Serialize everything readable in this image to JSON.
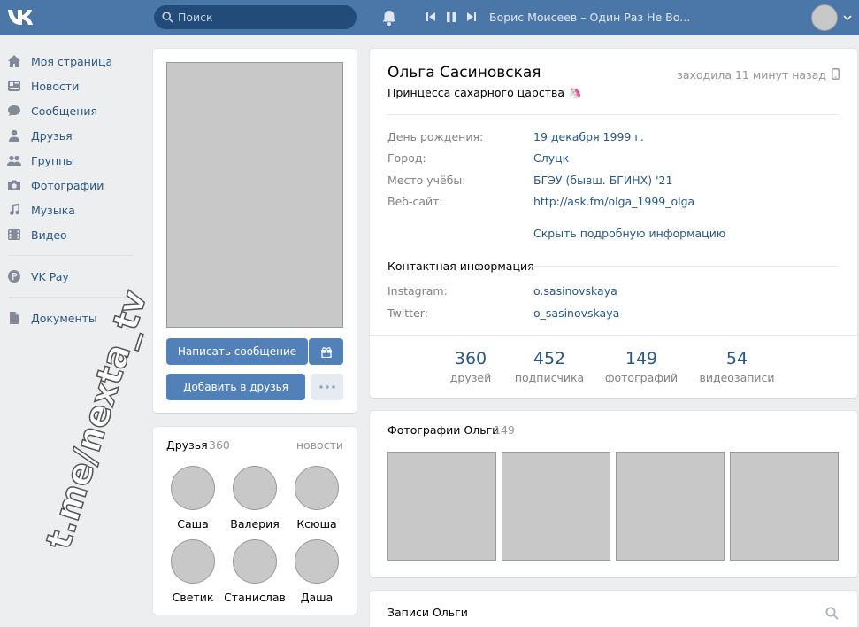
{
  "header": {
    "search_placeholder": "Поиск",
    "now_playing": "Борис Моисеев – Один Раз Не Во..."
  },
  "menu": [
    {
      "label": "Моя страница",
      "icon": "home-icon"
    },
    {
      "label": "Новости",
      "icon": "news-icon"
    },
    {
      "label": "Сообщения",
      "icon": "messages-icon"
    },
    {
      "label": "Друзья",
      "icon": "friends-icon"
    },
    {
      "label": "Группы",
      "icon": "groups-icon"
    },
    {
      "label": "Фотографии",
      "icon": "camera-icon"
    },
    {
      "label": "Музыка",
      "icon": "music-icon"
    },
    {
      "label": "Видео",
      "icon": "video-icon"
    },
    {
      "label": "VK Pay",
      "icon": "vkpay-icon"
    },
    {
      "label": "Документы",
      "icon": "document-icon"
    }
  ],
  "watermark": "t.me/nexta_tv",
  "profile": {
    "name": "Ольга Сасиновская",
    "status": "Принцесса сахарного царства 🦄",
    "last_seen": "заходила 11 минут назад",
    "info": [
      {
        "label": "День рождения:",
        "value": "19 декабря 1999 г."
      },
      {
        "label": "Город:",
        "value": "Слуцк"
      },
      {
        "label": "Место учёбы:",
        "value": "БГЭУ (бывш. БГИНХ) '21"
      },
      {
        "label": "Веб-сайт:",
        "value": "http://ask.fm/olga_1999_olga"
      }
    ],
    "hide_details": "Скрыть подробную информацию",
    "contact_title": "Контактная информация",
    "contacts": [
      {
        "label": "Instagram:",
        "value": "o.sasinovskaya"
      },
      {
        "label": "Twitter:",
        "value": "o_sasinovskaya"
      }
    ],
    "counters": [
      {
        "number": "360",
        "label": "друзей"
      },
      {
        "number": "452",
        "label": "подписчика"
      },
      {
        "number": "149",
        "label": "фотографий"
      },
      {
        "number": "54",
        "label": "видеозаписи"
      }
    ]
  },
  "actions": {
    "message": "Написать сообщение",
    "add_friend": "Добавить в друзья"
  },
  "friends": {
    "title": "Друзья",
    "count": "360",
    "news_link": "новости",
    "items": [
      "Саша",
      "Валерия",
      "Ксюша",
      "Светик",
      "Станислав",
      "Даша"
    ]
  },
  "photos": {
    "title": "Фотографии Ольги",
    "count": "149"
  },
  "wall": {
    "title": "Записи Ольги"
  },
  "colors": {
    "header": "#4a76a8",
    "accent": "#5181b8",
    "link": "#2a5885",
    "background": "#edeef0"
  }
}
